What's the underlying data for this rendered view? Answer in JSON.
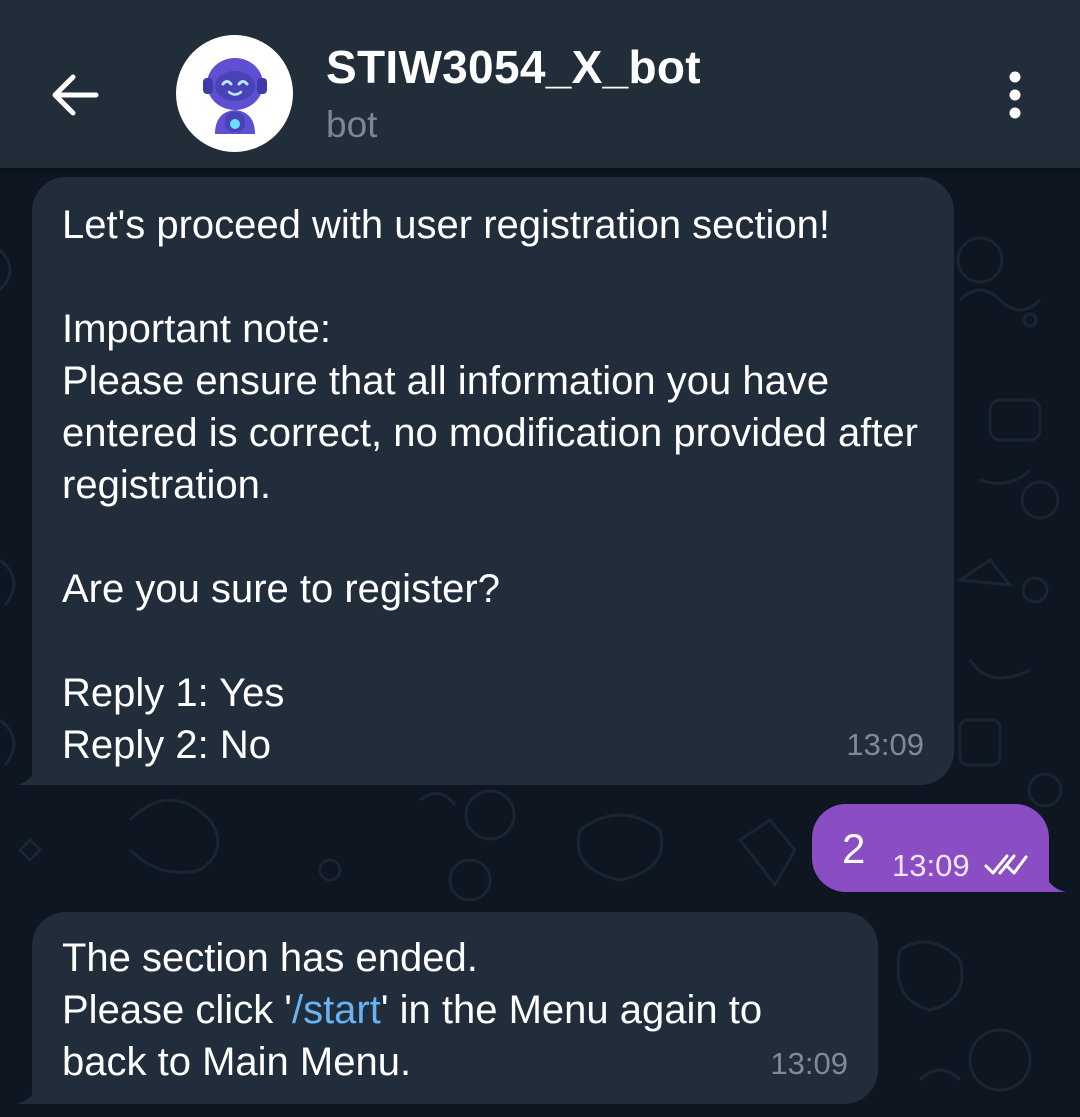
{
  "header": {
    "title": "STIW3054_X_bot",
    "subtitle": "bot"
  },
  "messages": {
    "m1": {
      "text": "Let's proceed with user registration section!\n\nImportant note:\nPlease ensure that all information you have entered is correct, no modification provided after registration.\n\nAre you sure to register?\n\nReply 1: Yes\nReply 2: No",
      "time": "13:09"
    },
    "m2": {
      "text": "2",
      "time": "13:09"
    },
    "m3": {
      "text_before": "The section has ended.\nPlease click '",
      "link": "/start",
      "text_after": "' in the Menu again to back to Main Menu.",
      "time": "13:09"
    }
  },
  "colors": {
    "background": "#0e1621",
    "header": "#222d3a",
    "incoming_bubble": "#212d3b",
    "outgoing_bubble": "#8a4dc4",
    "link": "#6ab3f3"
  },
  "icons": [
    "back-arrow-icon",
    "bot-avatar",
    "more-vert-icon",
    "double-check-icon"
  ]
}
